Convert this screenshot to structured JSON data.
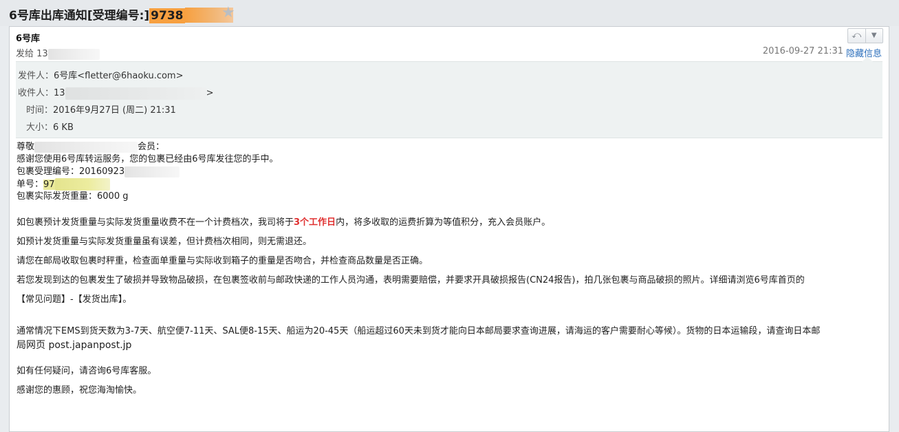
{
  "title": {
    "text": "6号库出库通知[受理编号:]",
    "highlight": "9738"
  },
  "header": {
    "from_name": "6号库",
    "sent_to_label": "发给",
    "sent_to_value": "13",
    "datetime": "2016-09-27 21:31",
    "hide_info": "隐藏信息",
    "reply_icon": "reply-icon",
    "dropdown_icon": "chevron-down-icon"
  },
  "details": {
    "sender_label": "发件人：",
    "sender_value": "6号库<fletter@6haoku.com>",
    "recipient_label": "收件人：",
    "recipient_value": "13",
    "recipient_end": ">",
    "time_label": "时间：",
    "time_value": "2016年9月27日 (周二) 21:31",
    "size_label": "大小：",
    "size_value": "6 KB"
  },
  "body": {
    "greeting_prefix": "尊敬",
    "greeting_suffix": "会员：",
    "thanks": "感谢您使用6号库转运服务，您的包裹已经由6号库发往您的手中。",
    "accept_no_label": "包裹受理编号：",
    "accept_no_value": "20160923",
    "tracking_label": "单号：",
    "tracking_value": "97",
    "weight": "包裹实际发货重量：6000 g",
    "p1_pre": "如包裹预计发货重量与实际发货重量收费不在一个计费档次，我司将于",
    "p1_red": "3个工作日",
    "p1_post": "内，将多收取的运费折算为等值积分，充入会员账户。",
    "p2": "如预计发货重量与实际发货重量虽有误差，但计费档次相同，则无需退还。",
    "p3": "请您在邮局收取包裹时秤重，检查面单重量与实际收到箱子的重量是否吻合，并检查商品数量是否正确。",
    "p4": "若您发现到达的包裹发生了破损并导致物品破损，在包裹签收前与邮政快递的工作人员沟通，表明需要赔偿，并要求开具破损报告(CN24报告)，拍几张包裹与商品破损的照片。详细请浏览6号库首页的",
    "p5": "【常见问题】-【发货出库】。",
    "p6a": "通常情况下EMS到货天数为3-7天、航空便7-11天、SAL便8-15天、船运为20-45天（船运超过60天未到货才能向日本邮局要求查询进展，请海运的客户需要耐心等候）。货物的日本运输段，请查询日本邮",
    "p6b": "局网页 post.japanpost.jp",
    "p7": "如有任何疑问，请咨询6号库客服。",
    "p8": "感谢您的惠顾，祝您海淘愉快。"
  }
}
